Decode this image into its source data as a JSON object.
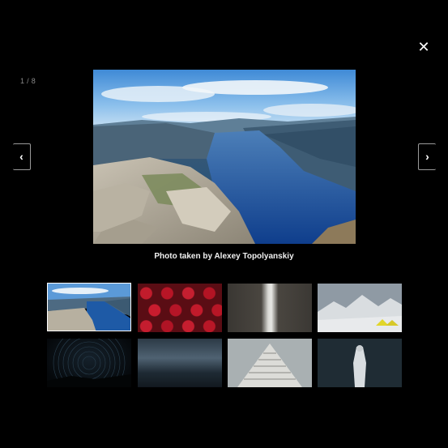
{
  "lightbox": {
    "counter": "1 / 8",
    "close_glyph": "✕",
    "prev_glyph": "‹",
    "next_glyph": "›",
    "caption": "Photo taken by Alexey Topolyanskiy",
    "accent": "#ffffff"
  },
  "thumbnails": [
    {
      "name": "thumb-fjord",
      "active": true
    },
    {
      "name": "thumb-strawberries",
      "active": false
    },
    {
      "name": "thumb-waterfall",
      "active": false
    },
    {
      "name": "thumb-mountains-tent",
      "active": false
    },
    {
      "name": "thumb-star-trails",
      "active": false
    },
    {
      "name": "thumb-stormy-sea",
      "active": false
    },
    {
      "name": "thumb-pyramid-building",
      "active": false
    },
    {
      "name": "thumb-person-in-blanket",
      "active": false
    }
  ],
  "icons": {
    "close": "close-icon",
    "prev": "chevron-left-icon",
    "next": "chevron-right-icon"
  }
}
